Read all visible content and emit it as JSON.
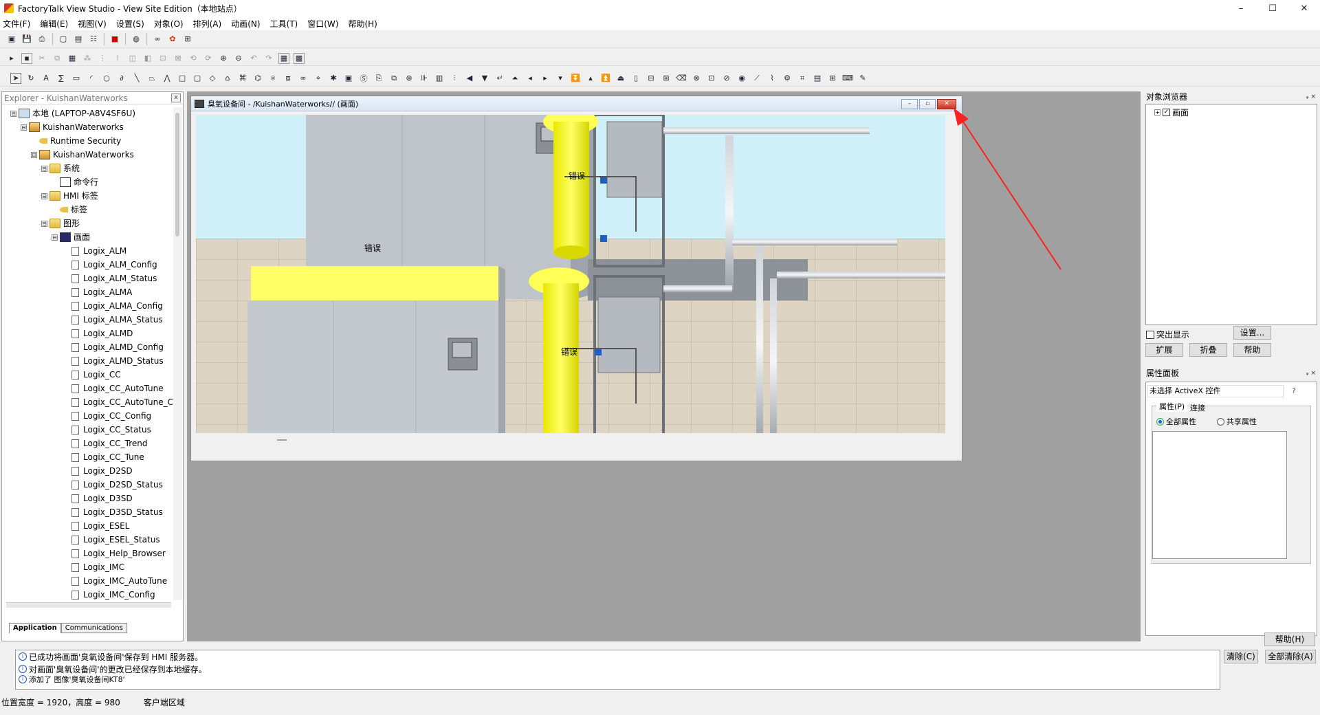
{
  "window": {
    "title": "FactoryTalk View Studio - View Site Edition（本地站点）",
    "minimize": "–",
    "maximize": "☐",
    "close": "✕"
  },
  "menu": [
    "文件(F)",
    "编辑(E)",
    "视图(V)",
    "设置(S)",
    "对象(O)",
    "排列(A)",
    "动画(N)",
    "工具(T)",
    "窗口(W)",
    "帮助(H)"
  ],
  "explorer": {
    "header": "Explorer - KuishanWaterworks",
    "close": "x",
    "tree": [
      {
        "label": "本地 (LAPTOP-A8V4SF6U)",
        "indent": 0,
        "pm": "⊟",
        "icon": "pc"
      },
      {
        "label": "KuishanWaterworks",
        "indent": 1,
        "pm": "⊟",
        "icon": "app"
      },
      {
        "label": "Runtime Security",
        "indent": 2,
        "pm": "",
        "icon": "key"
      },
      {
        "label": "KuishanWaterworks",
        "indent": 2,
        "pm": "⊟",
        "icon": "app"
      },
      {
        "label": "系统",
        "indent": 3,
        "pm": "⊟",
        "icon": "folder"
      },
      {
        "label": "命令行",
        "indent": 4,
        "pm": "",
        "icon": "cmd"
      },
      {
        "label": "HMI 标签",
        "indent": 3,
        "pm": "⊟",
        "icon": "folder"
      },
      {
        "label": "标签",
        "indent": 4,
        "pm": "",
        "icon": "key"
      },
      {
        "label": "图形",
        "indent": 3,
        "pm": "⊟",
        "icon": "folder"
      },
      {
        "label": "画面",
        "indent": 4,
        "pm": "⊟",
        "icon": "disp"
      },
      {
        "label": "Logix_ALM",
        "indent": 5,
        "pm": "",
        "icon": "doc"
      },
      {
        "label": "Logix_ALM_Config",
        "indent": 5,
        "pm": "",
        "icon": "doc"
      },
      {
        "label": "Logix_ALM_Status",
        "indent": 5,
        "pm": "",
        "icon": "doc"
      },
      {
        "label": "Logix_ALMA",
        "indent": 5,
        "pm": "",
        "icon": "doc"
      },
      {
        "label": "Logix_ALMA_Config",
        "indent": 5,
        "pm": "",
        "icon": "doc"
      },
      {
        "label": "Logix_ALMA_Status",
        "indent": 5,
        "pm": "",
        "icon": "doc"
      },
      {
        "label": "Logix_ALMD",
        "indent": 5,
        "pm": "",
        "icon": "doc"
      },
      {
        "label": "Logix_ALMD_Config",
        "indent": 5,
        "pm": "",
        "icon": "doc"
      },
      {
        "label": "Logix_ALMD_Status",
        "indent": 5,
        "pm": "",
        "icon": "doc"
      },
      {
        "label": "Logix_CC",
        "indent": 5,
        "pm": "",
        "icon": "doc"
      },
      {
        "label": "Logix_CC_AutoTune",
        "indent": 5,
        "pm": "",
        "icon": "doc"
      },
      {
        "label": "Logix_CC_AutoTune_C",
        "indent": 5,
        "pm": "",
        "icon": "doc"
      },
      {
        "label": "Logix_CC_Config",
        "indent": 5,
        "pm": "",
        "icon": "doc"
      },
      {
        "label": "Logix_CC_Status",
        "indent": 5,
        "pm": "",
        "icon": "doc"
      },
      {
        "label": "Logix_CC_Trend",
        "indent": 5,
        "pm": "",
        "icon": "doc"
      },
      {
        "label": "Logix_CC_Tune",
        "indent": 5,
        "pm": "",
        "icon": "doc"
      },
      {
        "label": "Logix_D2SD",
        "indent": 5,
        "pm": "",
        "icon": "doc"
      },
      {
        "label": "Logix_D2SD_Status",
        "indent": 5,
        "pm": "",
        "icon": "doc"
      },
      {
        "label": "Logix_D3SD",
        "indent": 5,
        "pm": "",
        "icon": "doc"
      },
      {
        "label": "Logix_D3SD_Status",
        "indent": 5,
        "pm": "",
        "icon": "doc"
      },
      {
        "label": "Logix_ESEL",
        "indent": 5,
        "pm": "",
        "icon": "doc"
      },
      {
        "label": "Logix_ESEL_Status",
        "indent": 5,
        "pm": "",
        "icon": "doc"
      },
      {
        "label": "Logix_Help_Browser",
        "indent": 5,
        "pm": "",
        "icon": "doc"
      },
      {
        "label": "Logix_IMC",
        "indent": 5,
        "pm": "",
        "icon": "doc"
      },
      {
        "label": "Logix_IMC_AutoTune",
        "indent": 5,
        "pm": "",
        "icon": "doc"
      },
      {
        "label": "Logix_IMC_Config",
        "indent": 5,
        "pm": "",
        "icon": "doc"
      }
    ],
    "tabs": {
      "application": "Application",
      "communications": "Communications"
    }
  },
  "display": {
    "title": "臭氧设备间 - /KuishanWaterworks// (画面)",
    "error_labels": [
      "错误",
      "错误",
      "错误"
    ]
  },
  "object_browser": {
    "title": "对象浏览器",
    "pin": "ᵩ ×",
    "tree_item": "画面",
    "highlight": "突出显示",
    "settings": "设置...",
    "expand": "扩展",
    "collapse": "折叠",
    "help": "帮助"
  },
  "property_panel": {
    "title": "属性面板",
    "pin": "ᵩ ×",
    "selection": "未选择 ActiveX 控件",
    "help_q": "?",
    "tab_properties": "属性(P)",
    "tab_connections": "连接",
    "radio_all": "全部属性",
    "radio_shared": "共享属性",
    "help_button": "帮助(H)"
  },
  "log": {
    "messages": [
      "已成功将画面'臭氧设备间'保存到 HMI 服务器。",
      "对画面'臭氧设备间'的更改已经保存到本地缓存。",
      "添加了 图像'臭氧设备间KT8'"
    ],
    "clear": "清除(C)",
    "clear_all": "全部清除(A)"
  },
  "status": {
    "size": "位置宽度 = 1920，高度 = 980",
    "region": "客户端区域"
  }
}
